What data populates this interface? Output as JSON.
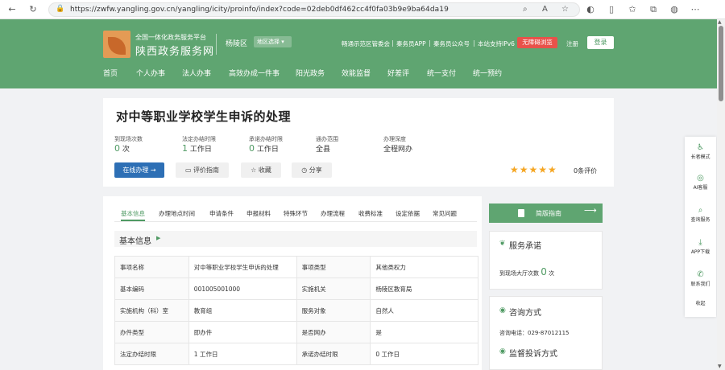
{
  "browser": {
    "url": "https://zwfw.yangling.gov.cn/yangling/icity/proinfo/index?code=02deb0df462cc4f0fa03b9e9ba64da19"
  },
  "header": {
    "logo_subtitle": "全国一体化政务服务平台",
    "logo_title": "陕西政务服务网",
    "region": "杨陵区",
    "region_select": "地区选择",
    "top_links": [
      "畅通示范区管委会",
      "秦务员APP",
      "秦务员公众号",
      "本站支持IPv6"
    ],
    "accessibility_button": "无障碍浏览",
    "register": "注册",
    "login": "登录",
    "nav": [
      "首页",
      "个人办事",
      "法人办事",
      "高效办成一件事",
      "阳光政务",
      "效能监督",
      "好差评",
      "统一支付",
      "统一预约"
    ]
  },
  "item": {
    "title": "对中等职业学校学生申诉的处理",
    "stats": [
      {
        "label": "到现场次数",
        "value": "0",
        "unit": "次"
      },
      {
        "label": "法定办结时限",
        "value": "1",
        "unit": "工作日"
      },
      {
        "label": "承诺办结时限",
        "value": "0",
        "unit": "工作日"
      },
      {
        "label": "通办范围",
        "value": "全县",
        "unit": ""
      },
      {
        "label": "办理深度",
        "value": "全程网办",
        "unit": ""
      }
    ],
    "buttons": {
      "online": "在线办理",
      "guide": "评价指南",
      "collect": "收藏",
      "share": "分享"
    },
    "stars": "★★★★★",
    "rating_text": "0条评价"
  },
  "tabs": [
    "基本信息",
    "办理地点时间",
    "申请条件",
    "申报材料",
    "特殊环节",
    "办理流程",
    "收费标准",
    "设定依据",
    "常见问题"
  ],
  "basic_info": {
    "title": "基本信息",
    "rows": [
      [
        "事项名称",
        "对中等职业学校学生申诉的处理",
        "事项类型",
        "其他类权力"
      ],
      [
        "基本编码",
        "001005001000",
        "实施机关",
        "杨陵区教育局"
      ],
      [
        "实施机构（科）室",
        "教育组",
        "服务对象",
        "自然人"
      ],
      [
        "办件类型",
        "即办件",
        "是否网办",
        "是"
      ],
      [
        "法定办结时限",
        "1 工作日",
        "承诺办结时限",
        "0 工作日"
      ]
    ]
  },
  "sidebar": {
    "simple_guide": "简版指南",
    "service_title": "服务承诺",
    "service_label": "到现场大厅次数",
    "service_value": "0",
    "service_unit": "次",
    "consult_title": "咨询方式",
    "consult_phone": "咨询电话：029-87012115",
    "complaint_title": "监督投诉方式"
  },
  "floatbar": [
    "长者模式",
    "AI客服",
    "查询服务",
    "APP下载",
    "联系我们",
    "收起"
  ],
  "colors": {
    "brand_green": "#5fa571",
    "primary_blue": "#2d6fb5",
    "star": "#f5a623",
    "alert_red": "#e8524a"
  }
}
